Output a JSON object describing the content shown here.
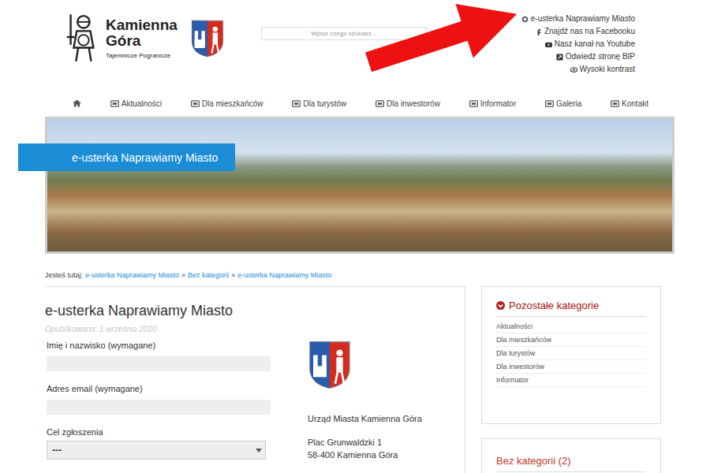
{
  "header": {
    "logo": {
      "title_lines": [
        "Kamienna",
        "Góra"
      ],
      "subtitle": "Tajemnicze Pogranicze"
    }
  },
  "search": {
    "placeholder": "Wpisz czego szukasz..."
  },
  "top_links": [
    "e-usterka Naprawiamy Miasto",
    "Znajdź nas na Facebooku",
    "Nasz kanał na Youtube",
    "Odwiedź stronę BIP",
    "Wysoki kontrast"
  ],
  "nav": [
    "Aktualności",
    "Dla mieszkańców",
    "Dla turystów",
    "Dla inwestorów",
    "Informator",
    "Galeria",
    "Kontakt"
  ],
  "banner": {
    "label": "e-usterka Naprawiamy Miasto"
  },
  "breadcrumb": {
    "prefix": "Jesteś tutaj:",
    "separator": "»",
    "items": [
      "e-usterka Naprawiamy Miasto",
      "Bez kategorii",
      "e-usterka Naprawiamy Miasto"
    ]
  },
  "article": {
    "title": "e-usterka Naprawiamy Miasto",
    "published": "Opublikowano: 1 września 2020",
    "fields": [
      {
        "label": "Imię i nazwisko (wymagane)",
        "kind": "text",
        "value": ""
      },
      {
        "label": "Adres email (wymagane)",
        "kind": "text",
        "value": ""
      },
      {
        "label": "Cel zgłoszenia",
        "kind": "select",
        "value": "---"
      }
    ],
    "address": [
      "Urząd Miasta Kamienna Góra",
      "Plac Grunwaldzki 1",
      "58-400 Kamienna Góra"
    ]
  },
  "sidebar": {
    "categories": {
      "title": "Pozostałe kategorie",
      "items": [
        "Aktualności",
        "Dla mieszkańców",
        "Dla turystów",
        "Dla inwestorów",
        "Informator"
      ]
    },
    "uncategorized": {
      "title": "Bez kategorii (2)"
    }
  }
}
